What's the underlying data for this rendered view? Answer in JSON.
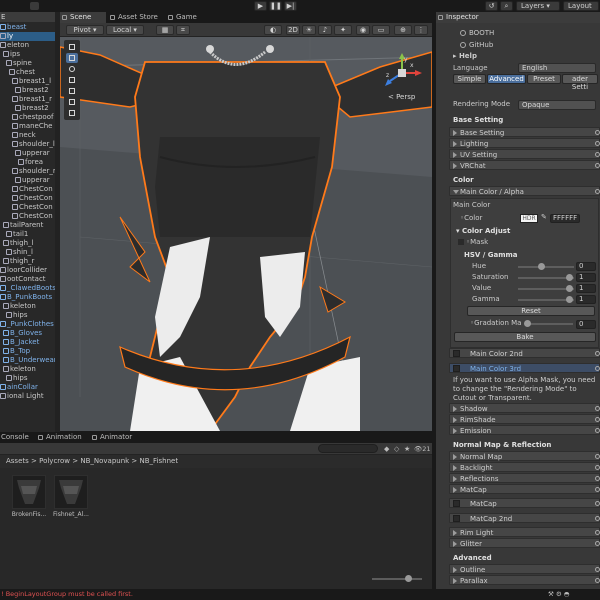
{
  "toolbar": {
    "layers": "Layers",
    "layout": "Layout"
  },
  "hierarchy": {
    "items": [
      {
        "label": "beast",
        "blue": true
      },
      {
        "label": "ly",
        "blue": false,
        "selected": true
      },
      {
        "label": "eleton",
        "blue": false
      },
      {
        "label": "ips",
        "blue": false
      },
      {
        "label": "spine",
        "blue": false
      },
      {
        "label": "chest",
        "blue": false
      },
      {
        "label": "breast1_l",
        "blue": false
      },
      {
        "label": "breast2",
        "blue": false
      },
      {
        "label": "breast1_r",
        "blue": false
      },
      {
        "label": "breast2",
        "blue": false
      },
      {
        "label": "chestpoof",
        "blue": false
      },
      {
        "label": "maneChe",
        "blue": false
      },
      {
        "label": "neck",
        "blue": false
      },
      {
        "label": "shoulder_l",
        "blue": false
      },
      {
        "label": "upperar",
        "blue": false
      },
      {
        "label": "forea",
        "blue": false
      },
      {
        "label": "shoulder_r",
        "blue": false
      },
      {
        "label": "upperar",
        "blue": false
      },
      {
        "label": "ChestCon",
        "blue": false
      },
      {
        "label": "ChestCon",
        "blue": false
      },
      {
        "label": "ChestCon",
        "blue": false
      },
      {
        "label": "ChestCon",
        "blue": false
      },
      {
        "label": "tailParent",
        "blue": false
      },
      {
        "label": "tail1",
        "blue": false
      },
      {
        "label": "thigh_l",
        "blue": false
      },
      {
        "label": "shin_l",
        "blue": false
      },
      {
        "label": "thigh_r",
        "blue": false
      },
      {
        "label": "loorCollider",
        "blue": false
      },
      {
        "label": "ootContact",
        "blue": false
      },
      {
        "label": "_ClawedBoots",
        "blue": true
      },
      {
        "label": "B_PunkBoots",
        "blue": true
      },
      {
        "label": "keleton",
        "blue": false
      },
      {
        "label": "hips",
        "blue": false
      },
      {
        "label": "_PunkClothes",
        "blue": true
      },
      {
        "label": "B_Gloves",
        "blue": true
      },
      {
        "label": "B_Jacket",
        "blue": true
      },
      {
        "label": "B_Top",
        "blue": true
      },
      {
        "label": "B_Underwear",
        "blue": true
      },
      {
        "label": "keleton",
        "blue": false
      },
      {
        "label": "hips",
        "blue": false
      },
      {
        "label": "ainCollar",
        "blue": true
      },
      {
        "label": "ional Light",
        "blue": false
      }
    ]
  },
  "scene": {
    "tabs": [
      "Scene",
      "Asset Store",
      "Game"
    ],
    "pivot": "Pivot",
    "local": "Local",
    "mode_2d": "2D",
    "persp": "< Persp",
    "gizmo_axes": [
      "y",
      "x",
      "z"
    ]
  },
  "bottom": {
    "tabs": [
      "Console",
      "Animation",
      "Animator"
    ],
    "breadcrumb": "Assets > Polycrow > NB_Novapunk > NB_Fishnet",
    "count": "21",
    "assets": [
      "BrokenFis...",
      "Fishnet_Al..."
    ]
  },
  "status": {
    "message": "BeginLayoutGroup must be called first."
  },
  "inspector": {
    "tab": "Inspector",
    "links": [
      "BOOTH",
      "GitHub"
    ],
    "help": "Help",
    "language_label": "Language",
    "language_value": "English",
    "modes": [
      "Simple",
      "Advanced",
      "Preset",
      "ader Setti"
    ],
    "rendering_label": "Rendering Mode",
    "rendering_value": "Opaque",
    "base_setting": {
      "title": "Base Setting",
      "items": [
        "Base Setting",
        "Lighting",
        "UV Setting",
        "VRChat"
      ]
    },
    "color": {
      "title": "Color",
      "main_alpha": "Main Color / Alpha",
      "main_color": "Main Color",
      "color_label": "Color",
      "hdr": "HDR",
      "hex": "FFFFFF",
      "adjust": "Color Adjust",
      "mask": "Mask",
      "hsv": "HSV / Gamma",
      "sliders": [
        {
          "label": "Hue",
          "value": "0",
          "pos": 0.5
        },
        {
          "label": "Saturation",
          "value": "1",
          "pos": 1.0
        },
        {
          "label": "Value",
          "value": "1",
          "pos": 1.0
        },
        {
          "label": "Gamma",
          "value": "1",
          "pos": 1.0
        }
      ],
      "reset": "Reset",
      "gradation": "Gradation Ma",
      "gradation_value": "0",
      "bake": "Bake",
      "main2": "Main Color 2nd",
      "main3": "Main Color 3rd",
      "note": "If you want to use Alpha Mask, you need to change the \"Rendering Mode\" to Cutout or Transparent.",
      "more": [
        "Shadow",
        "RimShade",
        "Emission"
      ]
    },
    "normal": {
      "title": "Normal Map & Reflection",
      "items": [
        "Normal Map",
        "Backlight",
        "Reflections",
        "MatCap"
      ],
      "matcap_items": [
        "MatCap",
        "MatCap 2nd"
      ],
      "rest": [
        "Rim Light",
        "Glitter"
      ]
    },
    "advanced": {
      "title": "Advanced",
      "items": [
        "Outline",
        "Parallax"
      ]
    }
  }
}
